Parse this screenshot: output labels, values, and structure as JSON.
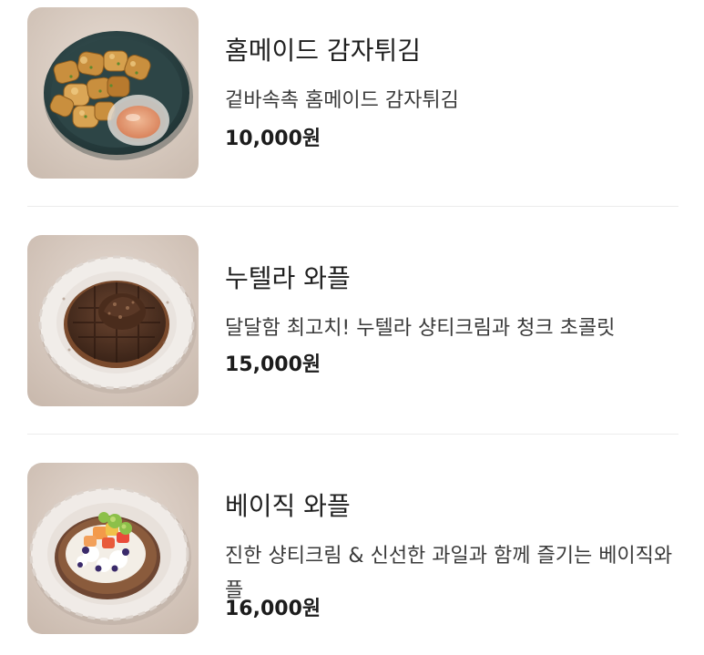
{
  "menu": {
    "items": [
      {
        "name": "홈메이드 감자튀김",
        "description": "겉바속촉 홈메이드 감자튀김",
        "price": "10,000원",
        "image": "fries-photo"
      },
      {
        "name": "누텔라 와플",
        "description": "달달함 최고치! 누텔라 샹티크림과 청크 초콜릿",
        "price": "15,000원",
        "image": "nutella-waffle-photo"
      },
      {
        "name": "베이직 와플",
        "description": "진한 샹티크림 & 신선한 과일과 함께 즐기는 베이직와플",
        "price": "16,000원",
        "image": "basic-waffle-photo"
      }
    ]
  },
  "colors": {
    "background": "#ffffff",
    "divider": "#ececec",
    "text": "#1f1f1f"
  }
}
